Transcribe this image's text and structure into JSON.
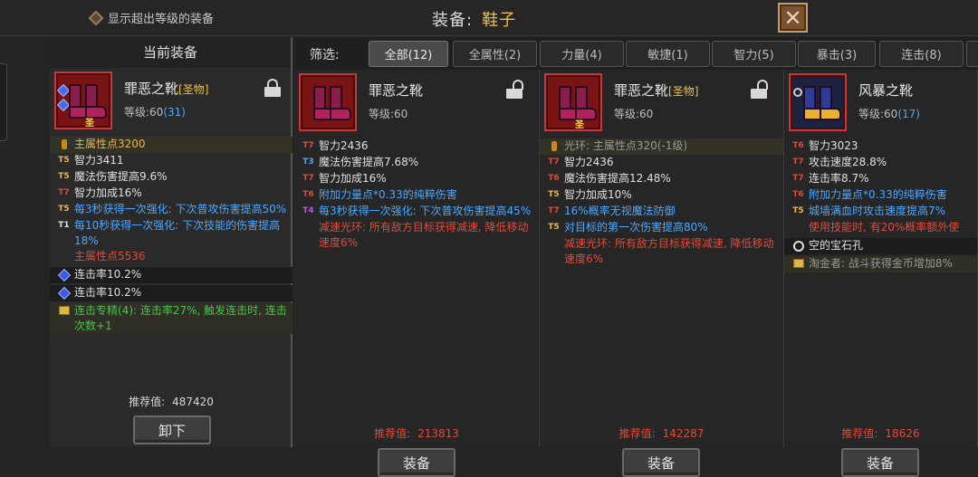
{
  "top": {
    "checkbox_label": "显示超出等级的装备",
    "title_label": "装备:",
    "title_value": "鞋子",
    "close_symbol": "✕"
  },
  "left": {
    "header": "当前装备",
    "item": {
      "name": "罪恶之靴",
      "tag": "[圣物]",
      "level_prefix": "等级:60",
      "level_bonus": "(31)",
      "holy_glyph": "圣"
    },
    "stats": [
      {
        "tier": "",
        "icon": "flask-icon",
        "text": "主属性点3200",
        "color": "o",
        "hl": true
      },
      {
        "tier": "T5",
        "text": "智力3411",
        "color": "w",
        "tcolor": "o"
      },
      {
        "tier": "T5",
        "text": "魔法伤害提高9.6%",
        "color": "w",
        "tcolor": "o"
      },
      {
        "tier": "T7",
        "text": "智力加成16%",
        "color": "w",
        "tcolor": "r"
      },
      {
        "tier": "T5",
        "text": "每3秒获得一次强化: 下次普攻伤害提高50%",
        "color": "b",
        "tcolor": "o"
      },
      {
        "tier": "T1",
        "text": "每10秒获得一次强化: 下次技能的伤害提高18%",
        "color": "b",
        "tcolor": "w"
      },
      {
        "tier": "",
        "text": "主属性点5536",
        "color": "r"
      },
      {
        "tier": "",
        "icon": "gem-icon",
        "text": "连击率10.2%",
        "color": "w",
        "gem": true
      },
      {
        "tier": "",
        "icon": "gem-icon",
        "text": "连击率10.2%",
        "color": "w",
        "gem": true
      },
      {
        "tier": "",
        "icon": "scroll-icon",
        "text": "连击专精(4): 连击率27%, 触发连击时, 连击次数+1",
        "color": "g",
        "gold": true
      }
    ],
    "rec_label": "推荐值:",
    "rec_value": "487420",
    "button": "卸下"
  },
  "filter": {
    "label": "筛选:",
    "tabs": [
      {
        "label": "全部(12)",
        "active": true
      },
      {
        "label": "全属性(2)"
      },
      {
        "label": "力量(4)"
      },
      {
        "label": "敏捷(1)"
      },
      {
        "label": "智力(5)"
      },
      {
        "label": "暴击(3)"
      },
      {
        "label": "连击(8)"
      },
      {
        "label": ""
      }
    ]
  },
  "cards": [
    {
      "name": "罪恶之靴",
      "tag": "",
      "level_prefix": "等级:60",
      "level_bonus": "",
      "holy": false,
      "stats": [
        {
          "tier": "T7",
          "text": "智力2436",
          "color": "w",
          "tcolor": "r"
        },
        {
          "tier": "T3",
          "text": "魔法伤害提高7.68%",
          "color": "w",
          "tcolor": "b"
        },
        {
          "tier": "T7",
          "text": "智力加成16%",
          "color": "w",
          "tcolor": "r"
        },
        {
          "tier": "T6",
          "text": "附加力量点*0.33的纯粹伤害",
          "color": "b",
          "tcolor": "r"
        },
        {
          "tier": "T4",
          "text": "每3秒获得一次强化: 下次普攻伤害提高45%",
          "color": "b",
          "tcolor": "p"
        },
        {
          "tier": "",
          "text": "减速光环: 所有敌方目标获得减速, 降低移动速度6%",
          "color": "r"
        }
      ],
      "rec_label": "推荐值:",
      "rec_value": "213813",
      "button": "装备"
    },
    {
      "name": "罪恶之靴",
      "tag": "[圣物]",
      "level_prefix": "等级:60",
      "level_bonus": "",
      "holy": true,
      "holy_glyph": "圣",
      "stats": [
        {
          "tier": "",
          "icon": "flask-icon",
          "text": "光环: 主属性点320(-1级)",
          "color": "gray",
          "hl": true
        },
        {
          "tier": "T7",
          "text": "智力2436",
          "color": "w",
          "tcolor": "r"
        },
        {
          "tier": "T6",
          "text": "魔法伤害提高12.48%",
          "color": "w",
          "tcolor": "r"
        },
        {
          "tier": "T5",
          "text": "智力加成10%",
          "color": "w",
          "tcolor": "o"
        },
        {
          "tier": "T7",
          "text": "16%概率无视魔法防御",
          "color": "b",
          "tcolor": "r"
        },
        {
          "tier": "T5",
          "text": "对目标的第一次伤害提高80%",
          "color": "b",
          "tcolor": "o"
        },
        {
          "tier": "",
          "text": "减速光环: 所有敌方目标获得减速, 降低移动速度6%",
          "color": "r"
        }
      ],
      "rec_label": "推荐值:",
      "rec_value": "142287",
      "button": "装备"
    },
    {
      "name": "风暴之靴",
      "tag": "",
      "level_prefix": "等级:60",
      "level_bonus": "(17)",
      "holy": false,
      "stats": [
        {
          "tier": "T6",
          "text": "智力3023",
          "color": "w",
          "tcolor": "r"
        },
        {
          "tier": "T7",
          "text": "攻击速度28.8%",
          "color": "w",
          "tcolor": "r"
        },
        {
          "tier": "T7",
          "text": "连击率8.7%",
          "color": "w",
          "tcolor": "r"
        },
        {
          "tier": "T6",
          "text": "附加力量点*0.33的纯粹伤害",
          "color": "b",
          "tcolor": "r"
        },
        {
          "tier": "T5",
          "text": "城墙满血时攻击速度提高7%",
          "color": "b",
          "tcolor": "o"
        },
        {
          "tier": "",
          "text": "使用技能时, 有20%概率额外使",
          "color": "r"
        },
        {
          "tier": "",
          "icon": "ring-icon",
          "text": "空的宝石孔",
          "color": "w",
          "gem": true
        },
        {
          "tier": "",
          "icon": "scroll-icon",
          "text": "淘金者: 战斗获得金币增加8%",
          "color": "gray",
          "gold": true
        }
      ],
      "rec_label": "推荐值:",
      "rec_value": "18626",
      "button": "装备"
    }
  ],
  "colors": {
    "accent": "#f0c040",
    "blue": "#4aa8ff",
    "red": "#e04a3a",
    "green": "#4ac24a"
  }
}
